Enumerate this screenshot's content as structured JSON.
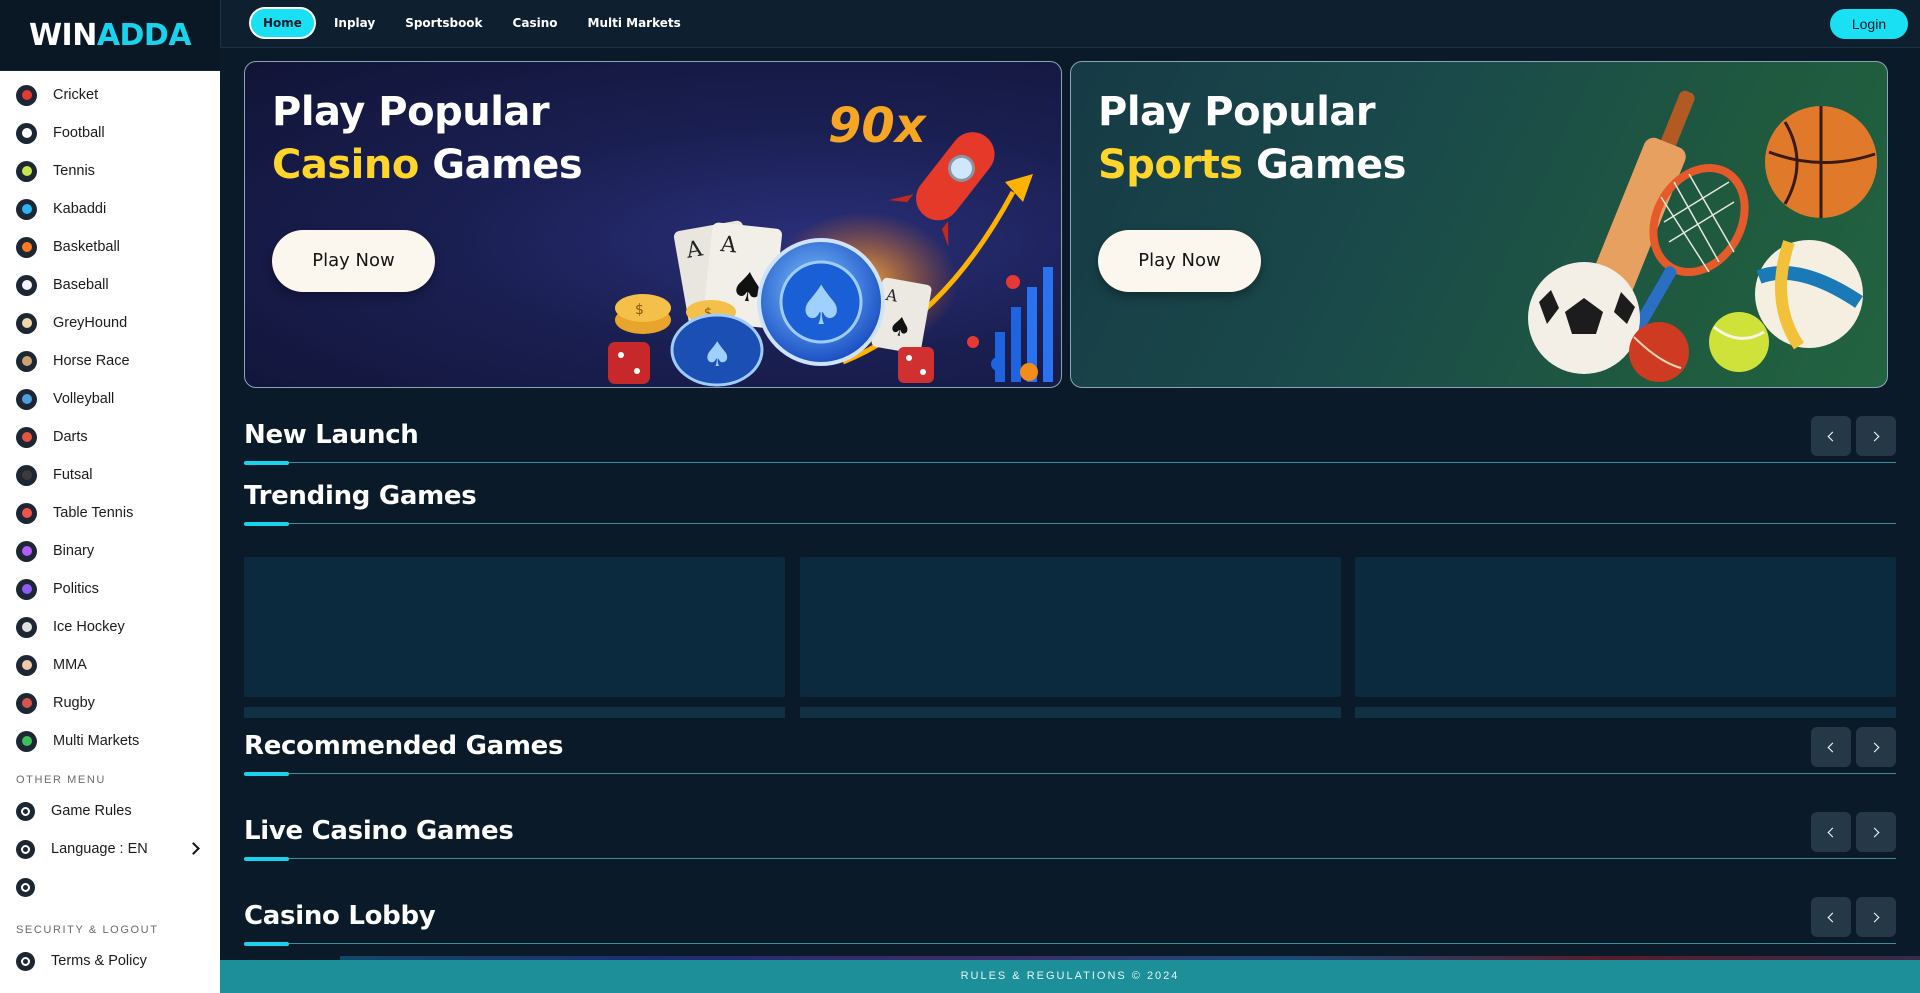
{
  "brand": {
    "logo_part1": "WIN",
    "logo_part2": "ADDA"
  },
  "nav": {
    "tabs": [
      {
        "label": "Home",
        "active": true
      },
      {
        "label": "Inplay"
      },
      {
        "label": "Sportsbook"
      },
      {
        "label": "Casino"
      },
      {
        "label": "Multi Markets"
      }
    ],
    "login_label": "Login"
  },
  "sidebar": {
    "sports": [
      {
        "label": "Cricket",
        "icon": "cricket-ball-icon",
        "color": "#e53935"
      },
      {
        "label": "Football",
        "icon": "football-icon",
        "color": "#ffffff"
      },
      {
        "label": "Tennis",
        "icon": "tennis-ball-icon",
        "color": "#c6e74b"
      },
      {
        "label": "Kabaddi",
        "icon": "kabaddi-icon",
        "color": "#29b6f6"
      },
      {
        "label": "Basketball",
        "icon": "basketball-icon",
        "color": "#ff7a21"
      },
      {
        "label": "Baseball",
        "icon": "baseball-icon",
        "color": "#f5f5f5"
      },
      {
        "label": "GreyHound",
        "icon": "greyhound-icon",
        "color": "#f2d7a6"
      },
      {
        "label": "Horse Race",
        "icon": "horse-icon",
        "color": "#caa371"
      },
      {
        "label": "Volleyball",
        "icon": "volleyball-icon",
        "color": "#4f9ede"
      },
      {
        "label": "Darts",
        "icon": "darts-icon",
        "color": "#e8533f"
      },
      {
        "label": "Futsal",
        "icon": "futsal-icon",
        "color": "#3b3b3b"
      },
      {
        "label": "Table Tennis",
        "icon": "table-tennis-icon",
        "color": "#ef5350"
      },
      {
        "label": "Binary",
        "icon": "binary-icon",
        "color": "#b05cff"
      },
      {
        "label": "Politics",
        "icon": "politics-icon",
        "color": "#8e5cf5"
      },
      {
        "label": "Ice Hockey",
        "icon": "ice-hockey-icon",
        "color": "#e0e0e0"
      },
      {
        "label": "MMA",
        "icon": "mma-icon",
        "color": "#f0c9a8"
      },
      {
        "label": "Rugby",
        "icon": "rugby-icon",
        "color": "#d9534f"
      },
      {
        "label": "Multi Markets",
        "icon": "multi-markets-icon",
        "color": "#3fbf5a"
      }
    ],
    "other_menu_heading": "OTHER MENU",
    "other_menu": [
      {
        "label": "Game Rules",
        "icon": "game-rules-icon"
      },
      {
        "label": "Language : EN",
        "icon": "globe-icon"
      },
      {
        "label": "",
        "icon": "theme-toggle-icon"
      }
    ],
    "security_heading": "SECURITY & LOGOUT",
    "security_menu": [
      {
        "label": "Terms & Policy",
        "icon": "shield-icon"
      }
    ]
  },
  "banners": {
    "casino": {
      "line1": "Play Popular",
      "highlight": "Casino",
      "line2_rest": " Games",
      "button": "Play Now",
      "multiplier": "90x"
    },
    "sports": {
      "line1": "Play Popular",
      "highlight": "Sports",
      "line2_rest": " Games",
      "button": "Play Now"
    }
  },
  "sections": {
    "new_launch": "New Launch",
    "trending": "Trending Games",
    "recommended": "Recommended Games",
    "live_casino": "Live Casino Games",
    "casino_lobby": "Casino Lobby"
  },
  "footer": {
    "text": "RULES & REGULATIONS © 2024"
  },
  "colors": {
    "accent": "#19e0f3",
    "background": "#0b1a29",
    "highlight": "#ffd52b",
    "footer": "#1c8f99"
  }
}
